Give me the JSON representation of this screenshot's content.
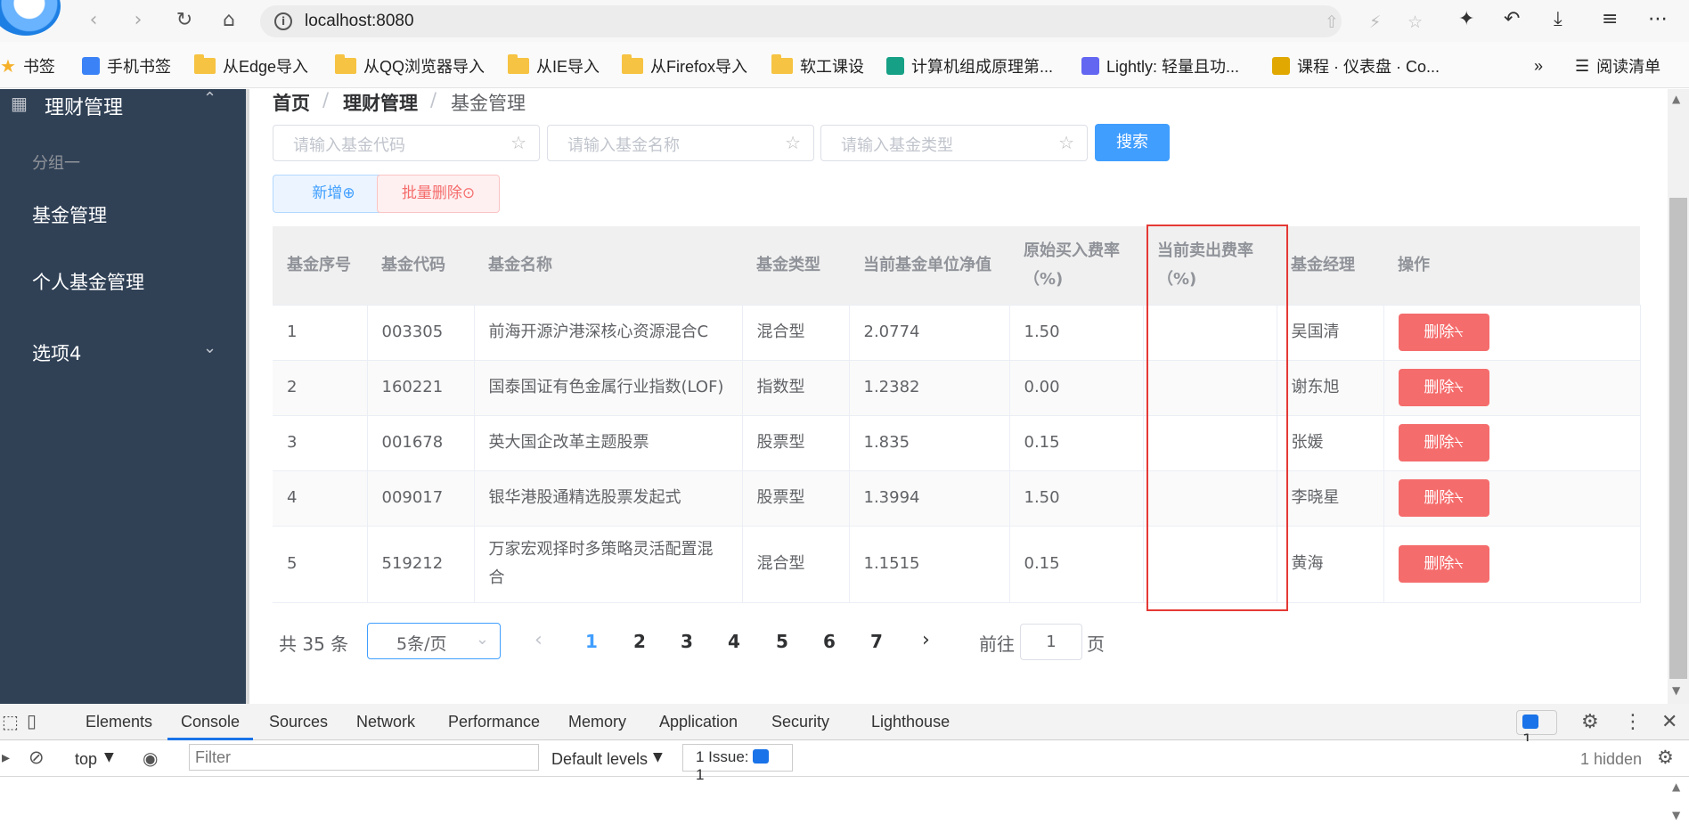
{
  "browser": {
    "url": "localhost:8080",
    "bookmarks": [
      "书签",
      "手机书签",
      "从Edge导入",
      "从QQ浏览器导入",
      "从IE导入",
      "从Firefox导入",
      "软工课设",
      "计算机组成原理第...",
      "Lightly: 轻量且功...",
      "课程 · 仪表盘 · Co..."
    ],
    "more": "»",
    "reading_list": "阅读清单"
  },
  "sidebar": {
    "menu_title": "理财管理",
    "group_label": "分组一",
    "items": [
      "基金管理",
      "个人基金管理",
      "选项4"
    ]
  },
  "breadcrumb": [
    "首页",
    "理财管理",
    "基金管理"
  ],
  "search": {
    "code_placeholder": "请输入基金代码",
    "name_placeholder": "请输入基金名称",
    "type_placeholder": "请输入基金类型",
    "button": "搜索"
  },
  "actions": {
    "add": "新增",
    "batch_delete": "批量删除"
  },
  "table": {
    "headers": [
      "基金序号",
      "基金代码",
      "基金名称",
      "基金类型",
      "当前基金单位净值",
      "原始买入费率（%)",
      "当前卖出费率（%)",
      "基金经理",
      "操作"
    ],
    "rows": [
      {
        "id": "1",
        "code": "003305",
        "name": "前海开源沪港深核心资源混合C",
        "type": "混合型",
        "nav": "2.0774",
        "buy_fee": "1.50",
        "sell_fee": "",
        "manager": "吴国清",
        "action": "删除"
      },
      {
        "id": "2",
        "code": "160221",
        "name": "国泰国证有色金属行业指数(LOF)",
        "type": "指数型",
        "nav": "1.2382",
        "buy_fee": "0.00",
        "sell_fee": "",
        "manager": "谢东旭",
        "action": "删除"
      },
      {
        "id": "3",
        "code": "001678",
        "name": "英大国企改革主题股票",
        "type": "股票型",
        "nav": "1.835",
        "buy_fee": "0.15",
        "sell_fee": "",
        "manager": "张媛",
        "action": "删除"
      },
      {
        "id": "4",
        "code": "009017",
        "name": "银华港股通精选股票发起式",
        "type": "股票型",
        "nav": "1.3994",
        "buy_fee": "1.50",
        "sell_fee": "",
        "manager": "李晓星",
        "action": "删除"
      },
      {
        "id": "5",
        "code": "519212",
        "name": "万家宏观择时多策略灵活配置混合",
        "type": "混合型",
        "nav": "1.1515",
        "buy_fee": "0.15",
        "sell_fee": "",
        "manager": "黄海",
        "action": "删除"
      }
    ]
  },
  "pagination": {
    "total": "共 35 条",
    "page_size": "5条/页",
    "pages": [
      "1",
      "2",
      "3",
      "4",
      "5",
      "6",
      "7"
    ],
    "current": "1",
    "goto_prefix": "前往",
    "goto_value": "1",
    "goto_suffix": "页"
  },
  "devtools": {
    "tabs": [
      "Elements",
      "Console",
      "Sources",
      "Network",
      "Performance",
      "Memory",
      "Application",
      "Security",
      "Lighthouse"
    ],
    "active_tab": "Console",
    "context": "top",
    "filter_placeholder": "Filter",
    "levels": "Default levels",
    "issues": "1 Issue:",
    "issue_count": "1",
    "message_count": "1",
    "hidden": "1 hidden"
  },
  "colors": {
    "sidebar_bg": "#304156",
    "primary": "#409eff",
    "danger": "#f56c6c",
    "highlight": "#e53935"
  }
}
